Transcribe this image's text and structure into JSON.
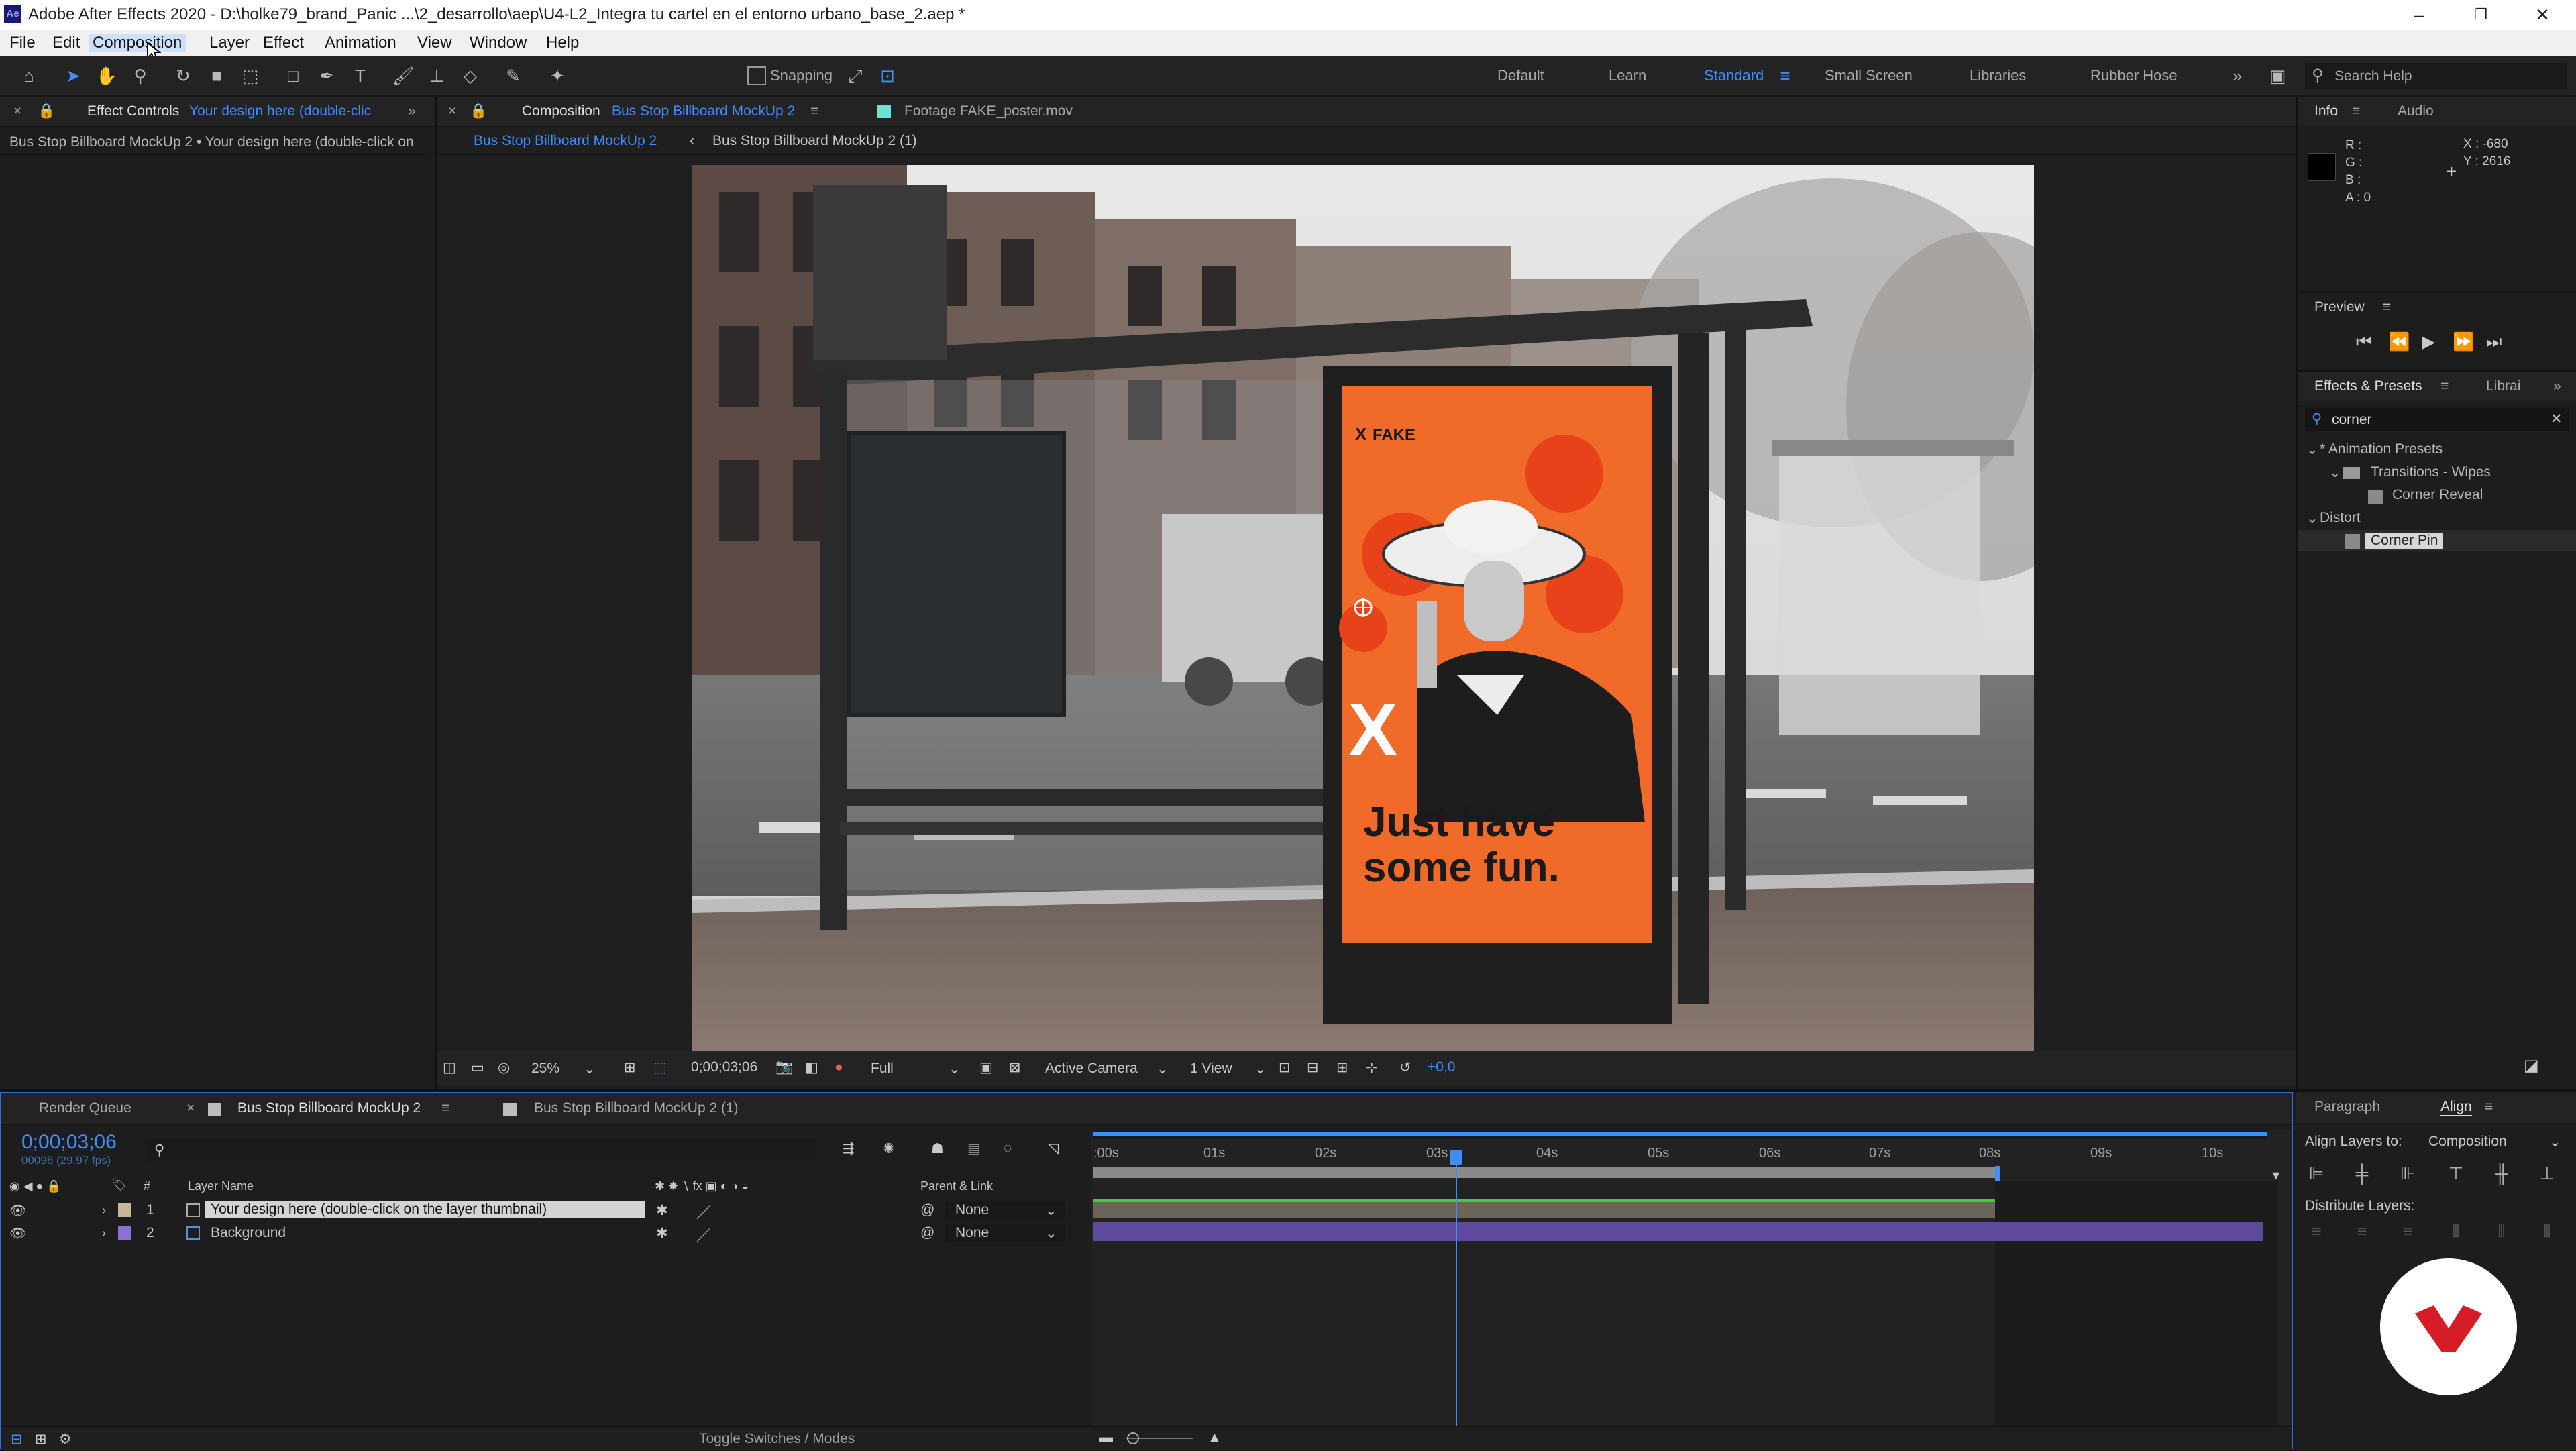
{
  "window": {
    "title": "Adobe After Effects 2020 - D:\\holke79_brand_Panic ...\\2_desarrollo\\aep\\U4-L2_Integra tu cartel en el entorno urbano_base_2.aep *",
    "app_icon": "Ae",
    "minimize": "–",
    "maximize": "❐",
    "close": "✕"
  },
  "menu": [
    "File",
    "Edit",
    "Composition",
    "Layer",
    "Effect",
    "Animation",
    "View",
    "Window",
    "Help"
  ],
  "toolbar": {
    "snapping": "Snapping",
    "workspaces": [
      "Default",
      "Learn",
      "Standard",
      "Small Screen",
      "Libraries",
      "Rubber Hose"
    ],
    "active_workspace": "Standard",
    "search_help": "Search Help"
  },
  "effect_controls": {
    "tab_label": "Effect Controls",
    "tab_layer": "Your design here (double-clic",
    "breadcrumb": "Bus Stop Billboard MockUp 2 • Your design here (double-click on"
  },
  "composition_panel": {
    "tab_label": "Composition",
    "tab_comp": "Bus Stop Billboard MockUp 2",
    "footage_tab": "Footage FAKE_poster.mov",
    "subtabs": [
      "Bus Stop Billboard MockUp 2",
      "Bus Stop Billboard MockUp 2 (1)"
    ],
    "viewer_bar": {
      "zoom": "25%",
      "timecode": "0;00;03;06",
      "resolution": "Full",
      "camera": "Active Camera",
      "views": "1 View",
      "exposure": "+0,0"
    },
    "poster": {
      "brand": "FAKE",
      "brand_mark": "X",
      "slogan_line1": "Just have",
      "slogan_line2": "some fun."
    }
  },
  "info_panel": {
    "tabs": [
      "Info",
      "Audio"
    ],
    "r": "R :",
    "g": "G :",
    "b": "B :",
    "a": "A : 0",
    "x": "X : -680",
    "y": "Y : 2616"
  },
  "preview_panel": {
    "title": "Preview"
  },
  "effects_presets": {
    "tabs": [
      "Effects & Presets",
      "Librai"
    ],
    "search_value": "corner",
    "tree": [
      {
        "label": "* Animation Presets",
        "level": 0
      },
      {
        "label": "Transitions - Wipes",
        "level": 1
      },
      {
        "label": "Corner Reveal",
        "level": 2
      },
      {
        "label": "Distort",
        "level": 0
      },
      {
        "label": "Corner Pin",
        "level": 1,
        "selected": true
      }
    ]
  },
  "timeline": {
    "tabs": [
      "Render Queue",
      "Bus Stop Billboard MockUp 2",
      "Bus Stop Billboard MockUp 2 (1)"
    ],
    "active_tab": "Bus Stop Billboard MockUp 2",
    "timecode": "0;00;03;06",
    "frame_info": "00096 (29.97 fps)",
    "columns": {
      "num": "#",
      "layer_name": "Layer Name",
      "parent": "Parent & Link"
    },
    "ruler": [
      ":00s",
      "01s",
      "02s",
      "03s",
      "04s",
      "05s",
      "06s",
      "07s",
      "08s",
      "09s",
      "10s"
    ],
    "layers": [
      {
        "num": "1",
        "name": "Your design here (double-click on the layer thumbnail)",
        "parent": "None",
        "color": "#c8b898"
      },
      {
        "num": "2",
        "name": "Background",
        "parent": "None",
        "color": "#8a72d4"
      }
    ],
    "toggle_label": "Toggle Switches / Modes"
  },
  "right_lower": {
    "tabs": [
      "Paragraph",
      "Align"
    ],
    "align_to_label": "Align Layers to:",
    "align_to_value": "Composition",
    "distribute_label": "Distribute Layers:"
  },
  "colors": {
    "accent": "#3f8eff",
    "poster_orange": "#f06a2a",
    "watermark_red": "#d61d25"
  }
}
